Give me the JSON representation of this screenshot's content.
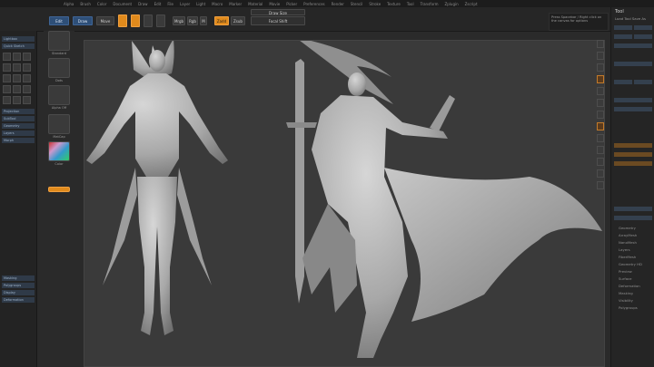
{
  "menu": {
    "items": [
      "Alpha",
      "Brush",
      "Color",
      "Document",
      "Draw",
      "Edit",
      "File",
      "Layer",
      "Light",
      "Macro",
      "Marker",
      "Material",
      "Movie",
      "Picker",
      "Preferences",
      "Render",
      "Stencil",
      "Stroke",
      "Texture",
      "Tool",
      "Transform",
      "Zplugin",
      "Zscript"
    ]
  },
  "toolbar": {
    "edit_label": "Edit",
    "draw_label": "Draw",
    "move_label": "Move",
    "scale_label": "Scale",
    "rotate_label": "Rotate",
    "zadd_label": "Zadd",
    "zsub_label": "Zsub",
    "rgb_label": "Rgb",
    "mrgb_label": "Mrgb",
    "m_label": "M",
    "focal_label": "Focal Shift",
    "draw_size_label": "Draw Size"
  },
  "left_tray": {
    "items": [
      "Lightbox",
      "Quick Sketch",
      "Projection",
      "SubTool",
      "Geometry",
      "Layers",
      "Morph",
      "Masking",
      "Polygroups",
      "Display",
      "Deformation"
    ]
  },
  "shelf": {
    "slots": [
      "Standard",
      "Dots",
      "Alpha Off",
      "Texture",
      "MatCap",
      "Color"
    ]
  },
  "right_panel": {
    "title": "Tool",
    "subtitle": "Load Tool  Save As",
    "list": [
      "Geometry",
      "ArrayMesh",
      "NanoMesh",
      "Layers",
      "FiberMesh",
      "Geometry HD",
      "Preview",
      "Surface",
      "Deformation",
      "Masking",
      "Visibility",
      "Polygroups"
    ]
  },
  "note": {
    "text": "Press Spacebar / Right click on the canvas for options"
  },
  "colors": {
    "accent_orange": "#e08a1c",
    "accent_blue": "#2e4f78",
    "background": "#2a2a2a",
    "canvas": "#3a3a3a",
    "model": "#b4b4b4"
  }
}
